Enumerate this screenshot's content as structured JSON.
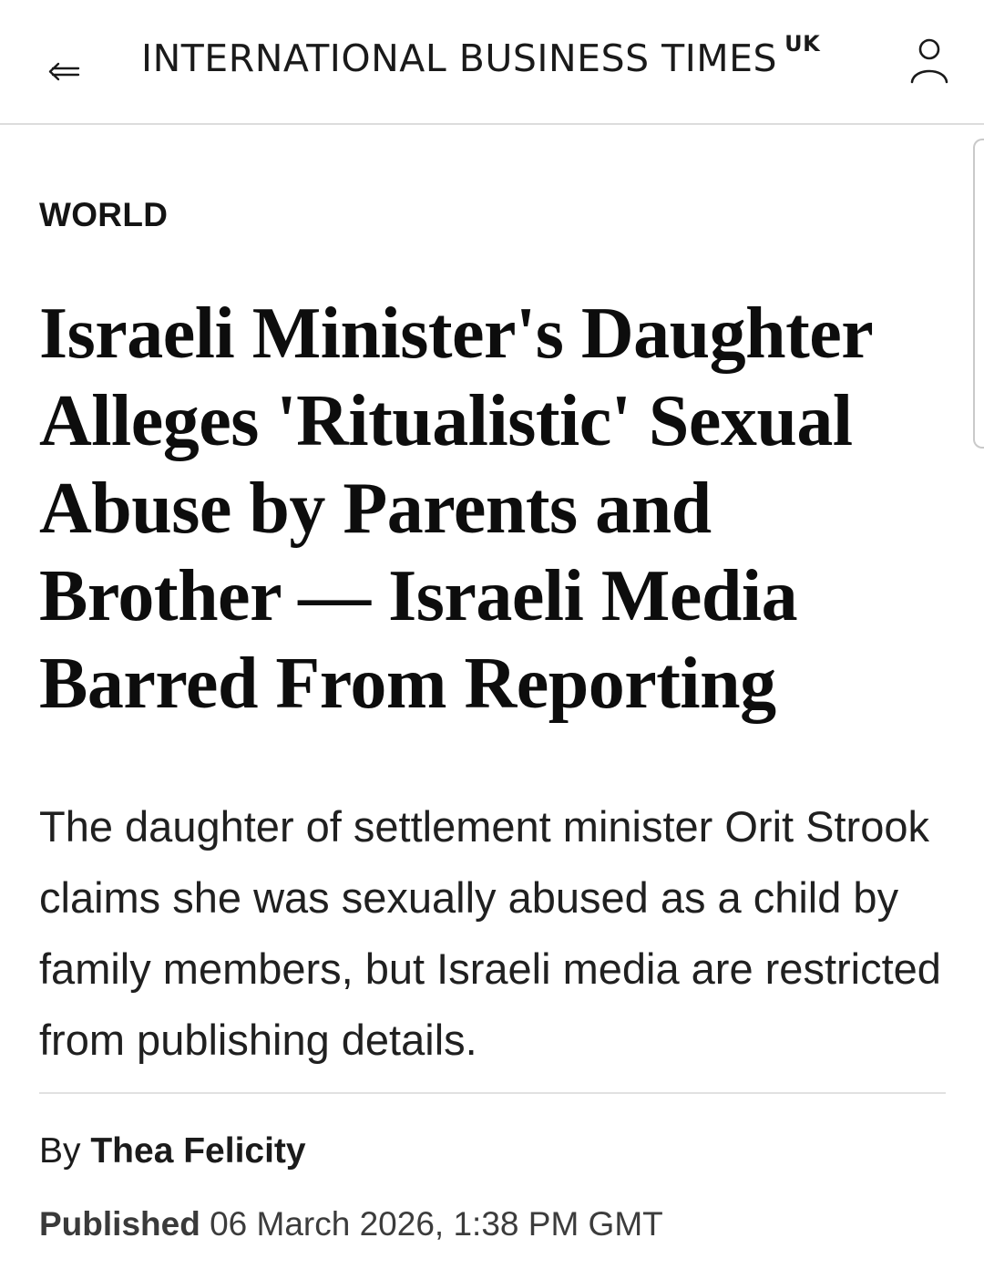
{
  "header": {
    "back_icon": "back-arrow-icon",
    "brand_name": "INTERNATIONAL BUSINESS TIMES",
    "brand_edition": "UK",
    "account_icon": "user-account-icon"
  },
  "article": {
    "section": "WORLD",
    "headline": "Israeli Minister's Daughter Alleges 'Ritualistic' Sexual Abuse by Parents and Brother — Israeli Media Barred From Reporting",
    "standfirst": "The daughter of settlement minister Orit Strook claims she was sexually abused as a child by family members, but Israeli media are restricted from publishing details.",
    "byline_prefix": "By",
    "author": "Thea Felicity",
    "published_label": "Published",
    "published_date": "06 March 2026, 1:38 PM GMT"
  },
  "colors": {
    "text": "#111111",
    "divider": "#e1e1e1",
    "header_border": "#dcdcdc",
    "background": "#ffffff"
  }
}
